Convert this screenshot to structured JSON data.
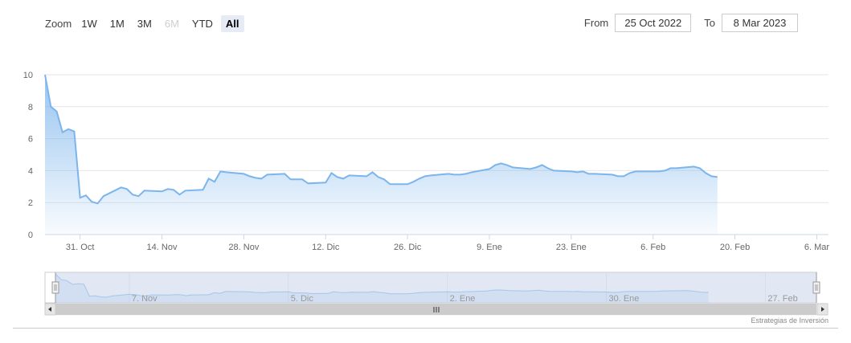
{
  "zoom": {
    "label": "Zoom",
    "buttons": [
      {
        "label": "1W",
        "state": "normal"
      },
      {
        "label": "1M",
        "state": "normal"
      },
      {
        "label": "3M",
        "state": "normal"
      },
      {
        "label": "6M",
        "state": "disabled"
      },
      {
        "label": "YTD",
        "state": "normal"
      },
      {
        "label": "All",
        "state": "active"
      }
    ]
  },
  "range": {
    "from_label": "From",
    "from_value": "25 Oct 2022",
    "to_label": "To",
    "to_value": "8 Mar 2023"
  },
  "credits": "Estrategias de Inversión",
  "colors": {
    "line": "#7cb5ec",
    "area_top": "#7cb5ec",
    "navigator_mask": "#c9d3ea",
    "grid": "#e6e6e6"
  },
  "chart_data": {
    "type": "area",
    "title": "",
    "xlabel": "",
    "ylabel": "",
    "ylim": [
      0,
      10
    ],
    "yticks": [
      "0",
      "2",
      "4",
      "6",
      "8",
      "10"
    ],
    "x_start": "2022-10-25",
    "x_end": "2023-03-08",
    "xticks": [
      {
        "date": "2022-10-31",
        "label": "31. Oct"
      },
      {
        "date": "2022-11-14",
        "label": "14. Nov"
      },
      {
        "date": "2022-11-28",
        "label": "28. Nov"
      },
      {
        "date": "2022-12-12",
        "label": "12. Dic"
      },
      {
        "date": "2022-12-26",
        "label": "26. Dic"
      },
      {
        "date": "2023-01-09",
        "label": "9. Ene"
      },
      {
        "date": "2023-01-23",
        "label": "23. Ene"
      },
      {
        "date": "2023-02-06",
        "label": "6. Feb"
      },
      {
        "date": "2023-02-20",
        "label": "20. Feb"
      },
      {
        "date": "2023-03-06",
        "label": "6. Mar"
      }
    ],
    "navigator_ticks": [
      {
        "date": "2022-11-07",
        "label": "7. Nov"
      },
      {
        "date": "2022-12-05",
        "label": "5. Dic"
      },
      {
        "date": "2023-01-02",
        "label": "2. Ene"
      },
      {
        "date": "2023-01-30",
        "label": "30. Ene"
      },
      {
        "date": "2023-02-27",
        "label": "27. Feb"
      }
    ],
    "grid": true,
    "legend": "none",
    "series": [
      {
        "values": [
          [
            "2022-10-25",
            10.0
          ],
          [
            "2022-10-26",
            8.0
          ],
          [
            "2022-10-27",
            7.7
          ],
          [
            "2022-10-28",
            6.4
          ],
          [
            "2022-10-29",
            6.6
          ],
          [
            "2022-10-30",
            6.45
          ],
          [
            "2022-10-31",
            2.3
          ],
          [
            "2022-11-01",
            2.45
          ],
          [
            "2022-11-02",
            2.05
          ],
          [
            "2022-11-03",
            1.95
          ],
          [
            "2022-11-04",
            2.4
          ],
          [
            "2022-11-07",
            2.95
          ],
          [
            "2022-11-08",
            2.85
          ],
          [
            "2022-11-09",
            2.5
          ],
          [
            "2022-11-10",
            2.4
          ],
          [
            "2022-11-11",
            2.75
          ],
          [
            "2022-11-14",
            2.7
          ],
          [
            "2022-11-15",
            2.85
          ],
          [
            "2022-11-16",
            2.8
          ],
          [
            "2022-11-17",
            2.5
          ],
          [
            "2022-11-18",
            2.75
          ],
          [
            "2022-11-21",
            2.8
          ],
          [
            "2022-11-22",
            3.5
          ],
          [
            "2022-11-23",
            3.3
          ],
          [
            "2022-11-24",
            3.95
          ],
          [
            "2022-11-25",
            3.9
          ],
          [
            "2022-11-28",
            3.8
          ],
          [
            "2022-11-29",
            3.65
          ],
          [
            "2022-11-30",
            3.55
          ],
          [
            "2022-12-01",
            3.5
          ],
          [
            "2022-12-02",
            3.75
          ],
          [
            "2022-12-05",
            3.8
          ],
          [
            "2022-12-06",
            3.45
          ],
          [
            "2022-12-07",
            3.45
          ],
          [
            "2022-12-08",
            3.45
          ],
          [
            "2022-12-09",
            3.2
          ],
          [
            "2022-12-12",
            3.25
          ],
          [
            "2022-12-13",
            3.85
          ],
          [
            "2022-12-14",
            3.6
          ],
          [
            "2022-12-15",
            3.5
          ],
          [
            "2022-12-16",
            3.7
          ],
          [
            "2022-12-19",
            3.65
          ],
          [
            "2022-12-20",
            3.9
          ],
          [
            "2022-12-21",
            3.6
          ],
          [
            "2022-12-22",
            3.45
          ],
          [
            "2022-12-23",
            3.15
          ],
          [
            "2022-12-26",
            3.15
          ],
          [
            "2022-12-27",
            3.3
          ],
          [
            "2022-12-28",
            3.5
          ],
          [
            "2022-12-29",
            3.65
          ],
          [
            "2022-12-30",
            3.7
          ],
          [
            "2023-01-02",
            3.8
          ],
          [
            "2023-01-03",
            3.75
          ],
          [
            "2023-01-04",
            3.75
          ],
          [
            "2023-01-05",
            3.8
          ],
          [
            "2023-01-06",
            3.9
          ],
          [
            "2023-01-09",
            4.1
          ],
          [
            "2023-01-10",
            4.35
          ],
          [
            "2023-01-11",
            4.45
          ],
          [
            "2023-01-12",
            4.35
          ],
          [
            "2023-01-13",
            4.2
          ],
          [
            "2023-01-16",
            4.1
          ],
          [
            "2023-01-17",
            4.2
          ],
          [
            "2023-01-18",
            4.35
          ],
          [
            "2023-01-19",
            4.15
          ],
          [
            "2023-01-20",
            4.0
          ],
          [
            "2023-01-23",
            3.95
          ],
          [
            "2023-01-24",
            3.9
          ],
          [
            "2023-01-25",
            3.95
          ],
          [
            "2023-01-26",
            3.8
          ],
          [
            "2023-01-27",
            3.8
          ],
          [
            "2023-01-30",
            3.75
          ],
          [
            "2023-01-31",
            3.65
          ],
          [
            "2023-02-01",
            3.65
          ],
          [
            "2023-02-02",
            3.85
          ],
          [
            "2023-02-03",
            3.95
          ],
          [
            "2023-02-06",
            3.95
          ],
          [
            "2023-02-07",
            3.95
          ],
          [
            "2023-02-08",
            4.0
          ],
          [
            "2023-02-09",
            4.15
          ],
          [
            "2023-02-10",
            4.15
          ],
          [
            "2023-02-13",
            4.25
          ],
          [
            "2023-02-14",
            4.15
          ],
          [
            "2023-02-15",
            3.85
          ],
          [
            "2023-02-16",
            3.65
          ],
          [
            "2023-02-17",
            3.6
          ]
        ]
      }
    ]
  }
}
